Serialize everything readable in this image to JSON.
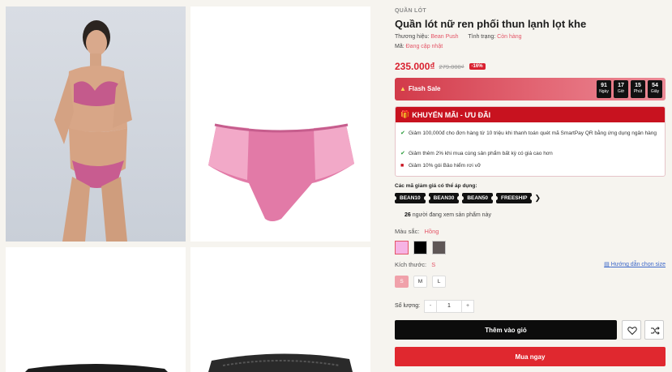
{
  "product": {
    "category": "QUẦN LÓT",
    "title": "Quần lót nữ ren phối thun lạnh lọt khe",
    "brand_label": "Thương hiệu:",
    "brand_value": "Bean Push",
    "status_label": "Tình trạng:",
    "status_value": "Còn hàng",
    "sku_label": "Mã:",
    "sku_value": "Đang cập nhật",
    "price": "235.000₫",
    "old_price": "279.000₫",
    "discount": "-16%"
  },
  "flash_sale": {
    "label": "Flash Sale",
    "timer": [
      {
        "value": "91",
        "unit": "Ngày"
      },
      {
        "value": "17",
        "unit": "Giờ"
      },
      {
        "value": "15",
        "unit": "Phút"
      },
      {
        "value": "54",
        "unit": "Giây"
      }
    ]
  },
  "promo": {
    "heading": "KHUYẾN MÃI - ƯU ĐÃI",
    "items": [
      "Giảm 100,000đ cho đơn hàng từ 10 triệu khi thanh toán quét mã SmartPay QR bằng ứng dụng ngân hàng",
      "Giảm thêm 2% khi mua cùng sản phẩm bất kỳ có giá cao hơn",
      "Giảm 10% gói Bảo hiểm rơi vỡ"
    ]
  },
  "coupons": {
    "label": "Các mã giảm giá có thể áp dụng:",
    "codes": [
      "BEAN10",
      "BEAN30",
      "BEAN50",
      "FREESHIP"
    ]
  },
  "viewing": {
    "count": "26",
    "text": "người đang xem sản phẩm này"
  },
  "variants": {
    "color_label": "Màu sắc:",
    "color_selected": "Hồng",
    "colors": [
      "#f6b3e4",
      "#000000",
      "#5e5656"
    ],
    "size_label": "Kích thước:",
    "size_selected": "S",
    "size_guide": "Hướng dẫn chọn size",
    "sizes": [
      "S",
      "M",
      "L"
    ]
  },
  "quantity": {
    "label": "Số lượng:",
    "minus": "-",
    "value": "1",
    "plus": "+"
  },
  "actions": {
    "add_to_cart": "Thêm vào giỏ",
    "buy_now": "Mua ngay"
  }
}
